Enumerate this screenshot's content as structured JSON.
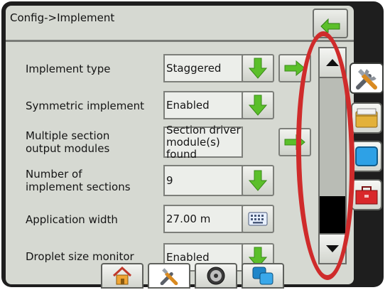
{
  "header": {
    "title": "Config->Implement"
  },
  "rows": [
    {
      "label": "Implement type",
      "value": "Staggered"
    },
    {
      "label": "Symmetric implement",
      "value": "Enabled"
    },
    {
      "label_line1": "Multiple section",
      "label_line2": "output modules",
      "value_line1": "Section driver",
      "value_line2": "module(s) found"
    },
    {
      "label_line1": "Number of",
      "label_line2": "implement sections",
      "value": "9"
    },
    {
      "label": "Application width",
      "value": "27.00 m"
    },
    {
      "label": "Droplet size monitor",
      "value": "Enabled"
    }
  ],
  "icons": {
    "back": "back-arrow-icon",
    "down": "green-down-arrow-icon",
    "right": "green-right-arrow-icon",
    "keyboard": "keyboard-icon",
    "scroll_up": "triangle-up-icon",
    "scroll_down": "triangle-down-icon",
    "side_tabs": [
      "tools-icon",
      "folder-icon",
      "display-icon",
      "toolbox-icon"
    ],
    "bottom_tabs": [
      "home-icon",
      "tools-icon",
      "gauge-icon",
      "screens-icon"
    ]
  },
  "colors": {
    "accent_green": "#5bbf2a",
    "highlight_red": "#cf2b2b",
    "background": "#d6d9d2"
  }
}
